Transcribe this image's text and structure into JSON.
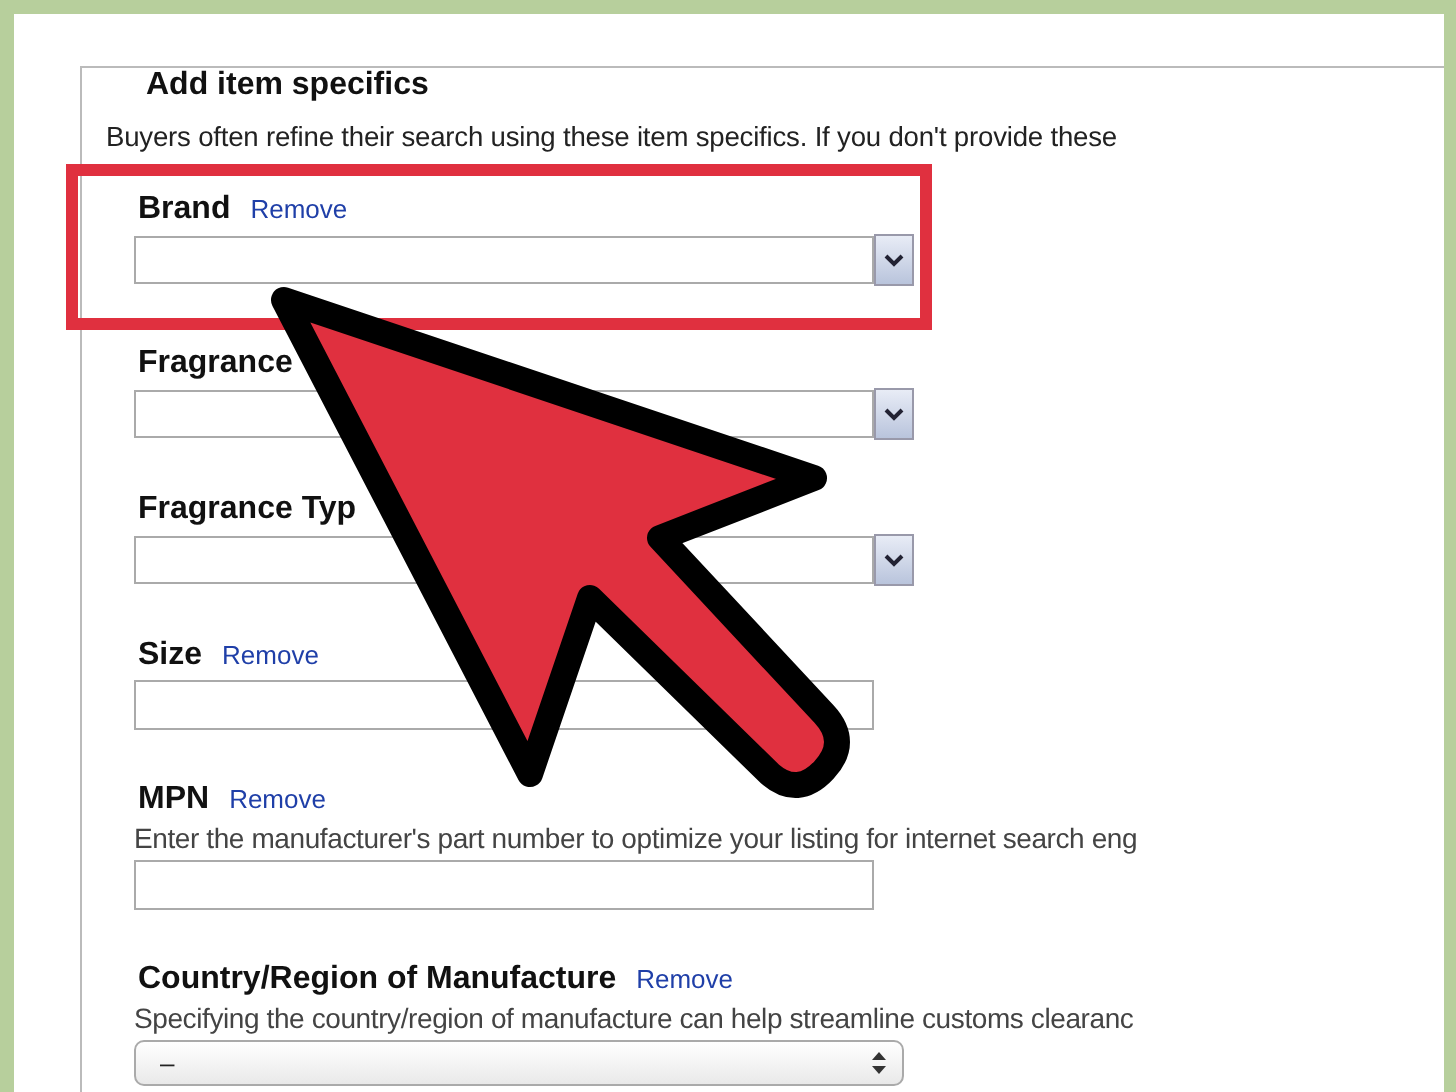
{
  "section": {
    "title": "Add item specifics",
    "intro": "Buyers often refine their search using these item specifics. If you don't provide these",
    "fields": [
      {
        "label": "Brand",
        "remove": "Remove",
        "kind": "dropdown",
        "highlighted": true
      },
      {
        "label": "Fragrance",
        "kind": "dropdown",
        "highlighted": false
      },
      {
        "label": "Fragrance Typ",
        "kind": "dropdown",
        "highlighted": false
      },
      {
        "label": "Size",
        "remove": "Remove",
        "kind": "text",
        "highlighted": false
      },
      {
        "label": "MPN",
        "remove": "Remove",
        "description": "Enter the manufacturer's part number to optimize your listing for internet search eng",
        "kind": "text",
        "highlighted": false
      },
      {
        "label": "Country/Region of Manufacture",
        "remove": "Remove",
        "description": "Specifying the country/region of manufacture can help streamline customs clearanc",
        "kind": "select",
        "value": "–",
        "highlighted": false
      }
    ]
  }
}
